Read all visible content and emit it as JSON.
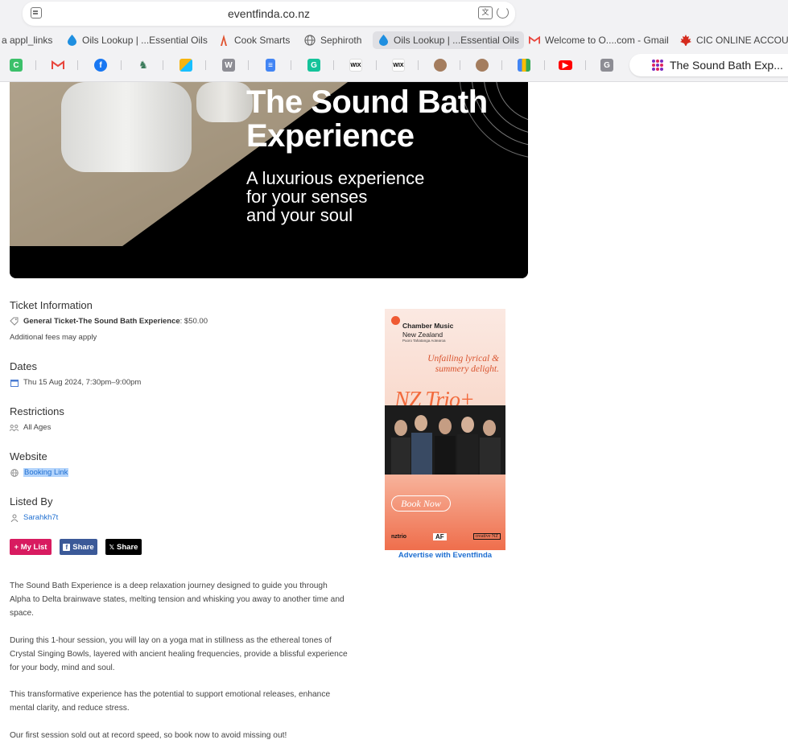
{
  "browser": {
    "url": "eventfinda.co.nz",
    "favorites": [
      {
        "label": "a appl_links",
        "icon": ""
      },
      {
        "label": "Oils Lookup | ...Essential Oils",
        "icon": "droplet-icon"
      },
      {
        "label": "Cook Smarts",
        "icon": "chef-icon"
      },
      {
        "label": "Sephiroth",
        "icon": "globe-icon"
      },
      {
        "label": "Oils Lookup | ...Essential Oils",
        "icon": "droplet-icon"
      },
      {
        "label": "Welcome to O....com - Gmail",
        "icon": "gmail-icon"
      },
      {
        "label": "CIC ONLINE ACCOUNT",
        "icon": "maple-leaf-icon"
      }
    ],
    "tab_icons": [
      "c",
      "m",
      "f",
      "d",
      "a",
      "W",
      "d",
      "G",
      "wix",
      "wix",
      "p",
      "p",
      "c",
      "y",
      "G"
    ],
    "active_tab": "The Sound Bath Exp..."
  },
  "hero": {
    "title_line1": "The Sound Bath",
    "title_line2": "Experience",
    "subtitle_line1": "A luxurious experience",
    "subtitle_line2": "for your senses",
    "subtitle_line3": "and your soul"
  },
  "ticket": {
    "heading": "Ticket Information",
    "name": "General Ticket-The Sound Bath Experience",
    "price": ": $50.00",
    "note": "Additional fees may apply"
  },
  "dates": {
    "heading": "Dates",
    "value": "Thu 15 Aug 2024, 7:30pm–9:00pm"
  },
  "restrictions": {
    "heading": "Restrictions",
    "value": "All Ages"
  },
  "website": {
    "heading": "Website",
    "link": "Booking Link"
  },
  "listed_by": {
    "heading": "Listed By",
    "user": "Sarahkh7t"
  },
  "actions": {
    "my_list": "+ My List",
    "fb_share": "Share",
    "x_share": "Share"
  },
  "description": [
    "The Sound Bath Experience is a deep relaxation journey designed to guide you through Alpha to Delta brainwave states, melting tension and whisking you away to another time and space.",
    "During this 1-hour session, you will lay on a yoga mat in stillness as the ethereal tones of Crystal Singing Bowls, layered with ancient healing frequencies, provide a blissful experience for your body, mind and soul.",
    "This transformative experience has the potential to support emotional releases, enhance mental clarity, and reduce stress.",
    "Our first session sold out at record speed, so book now to avoid missing out!"
  ],
  "ad": {
    "org_line1": "Chamber Music",
    "org_line2": "New Zealand",
    "org_line3": "Puoro Tahatanga Aotearoa",
    "tagline_line1": "Unfailing lyrical &",
    "tagline_line2": "summery delight.",
    "show": "NZ Trio+",
    "cta": "Book Now",
    "logo1": "nztrio",
    "logo2": "AF",
    "logo3": "creative NZ",
    "advertise_link": "Advertise with Eventfinda"
  },
  "colors": {
    "link": "#1f6fd1",
    "my_list_bg": "#d81b60",
    "facebook_bg": "#3b5998",
    "x_bg": "#000000",
    "ad_accent": "#ef5a33"
  }
}
